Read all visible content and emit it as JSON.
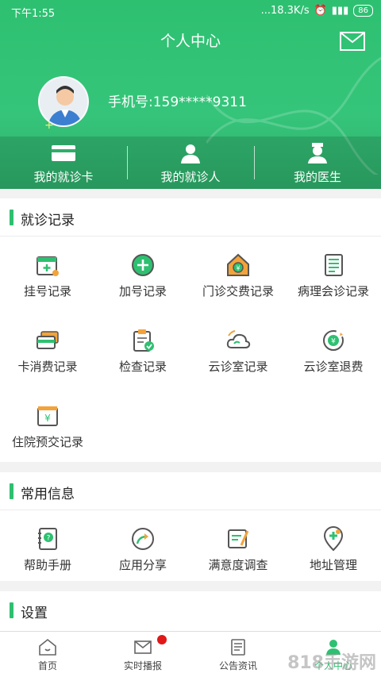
{
  "status": {
    "time": "下午1:55",
    "speed": "...18.3K/s",
    "battery": "86"
  },
  "header": {
    "title": "个人中心",
    "phone": "手机号:159*****9311"
  },
  "quick": [
    {
      "label": "我的就诊卡"
    },
    {
      "label": "我的就诊人"
    },
    {
      "label": "我的医生"
    }
  ],
  "records": {
    "title": "就诊记录",
    "items": [
      {
        "label": "挂号记录"
      },
      {
        "label": "加号记录"
      },
      {
        "label": "门诊交费记录"
      },
      {
        "label": "病理会诊记录"
      },
      {
        "label": "卡消费记录"
      },
      {
        "label": "检查记录"
      },
      {
        "label": "云诊室记录"
      },
      {
        "label": "云诊室退费"
      },
      {
        "label": "住院预交记录"
      }
    ]
  },
  "info": {
    "title": "常用信息",
    "items": [
      {
        "label": "帮助手册"
      },
      {
        "label": "应用分享"
      },
      {
        "label": "满意度调查"
      },
      {
        "label": "地址管理"
      }
    ]
  },
  "settings": {
    "title": "设置"
  },
  "nav": [
    {
      "label": "首页"
    },
    {
      "label": "实时播报"
    },
    {
      "label": "公告资讯"
    },
    {
      "label": "个人中心"
    }
  ],
  "watermark": "818手游网",
  "colors": {
    "accent": "#2ec071",
    "badge": "#e01818"
  }
}
